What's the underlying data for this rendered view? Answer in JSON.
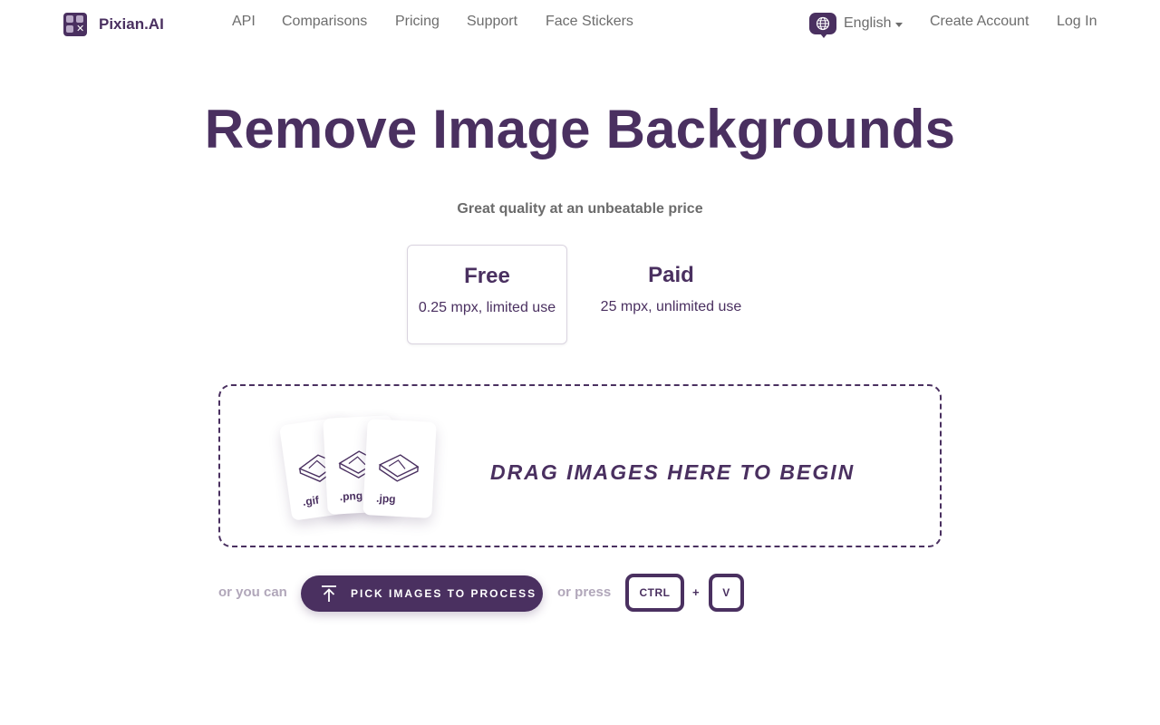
{
  "brand": {
    "name": "Pixian.AI"
  },
  "nav": {
    "links": [
      "API",
      "Comparisons",
      "Pricing",
      "Support",
      "Face Stickers"
    ],
    "language": "English",
    "create_account": "Create Account",
    "log_in": "Log In"
  },
  "hero": {
    "title": "Remove Image Backgrounds",
    "tagline": "Great quality at an unbeatable price"
  },
  "plans": [
    {
      "name": "Free",
      "desc": "0.25 mpx, limited use",
      "selected": true
    },
    {
      "name": "Paid",
      "desc": "25 mpx, unlimited use",
      "selected": false
    }
  ],
  "dropzone": {
    "text": "DRAG IMAGES HERE TO BEGIN",
    "file_types": [
      ".gif",
      ".png",
      ".jpg"
    ]
  },
  "actions": {
    "or_you_can": "or you can",
    "pick_button": "PICK IMAGES TO PROCESS",
    "or_press": "or press",
    "key_ctrl": "CTRL",
    "key_plus": "+",
    "key_v": "V"
  },
  "colors": {
    "brand": "#4a3060",
    "muted": "#b1a7ba",
    "nav_text": "#6d6d6d"
  },
  "icons": [
    "logo-icon",
    "globe-icon",
    "chevron-down-icon",
    "upload-icon",
    "image-file-icon"
  ]
}
